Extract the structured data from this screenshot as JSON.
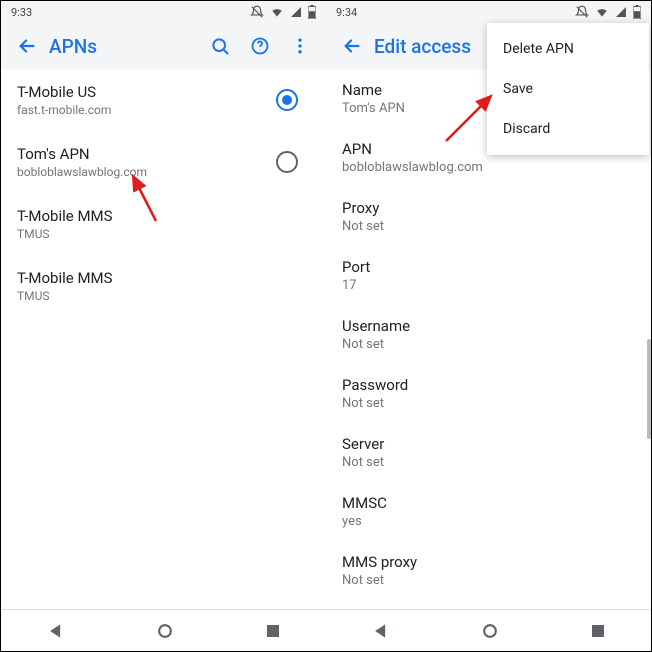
{
  "left": {
    "statusbar": {
      "time": "9:33"
    },
    "appbar": {
      "title": "APNs"
    },
    "apns": [
      {
        "name": "T-Mobile US",
        "sub": "fast.t-mobile.com",
        "selected": true
      },
      {
        "name": "Tom's APN",
        "sub": "bobloblawslawblog.com",
        "selected": false
      },
      {
        "name": "T-Mobile MMS",
        "sub": "TMUS",
        "selected": null
      },
      {
        "name": "T-Mobile MMS",
        "sub": "TMUS",
        "selected": null
      }
    ]
  },
  "right": {
    "statusbar": {
      "time": "9:34"
    },
    "appbar": {
      "title": "Edit access"
    },
    "menu": {
      "items": [
        {
          "label": "Delete APN"
        },
        {
          "label": "Save"
        },
        {
          "label": "Discard"
        }
      ]
    },
    "details": [
      {
        "label": "Name",
        "value": "Tom's APN"
      },
      {
        "label": "APN",
        "value": "bobloblawslawblog.com"
      },
      {
        "label": "Proxy",
        "value": "Not set"
      },
      {
        "label": "Port",
        "value": "17"
      },
      {
        "label": "Username",
        "value": "Not set"
      },
      {
        "label": "Password",
        "value": "Not set"
      },
      {
        "label": "Server",
        "value": "Not set"
      },
      {
        "label": "MMSC",
        "value": "yes"
      },
      {
        "label": "MMS proxy",
        "value": "Not set"
      }
    ]
  }
}
